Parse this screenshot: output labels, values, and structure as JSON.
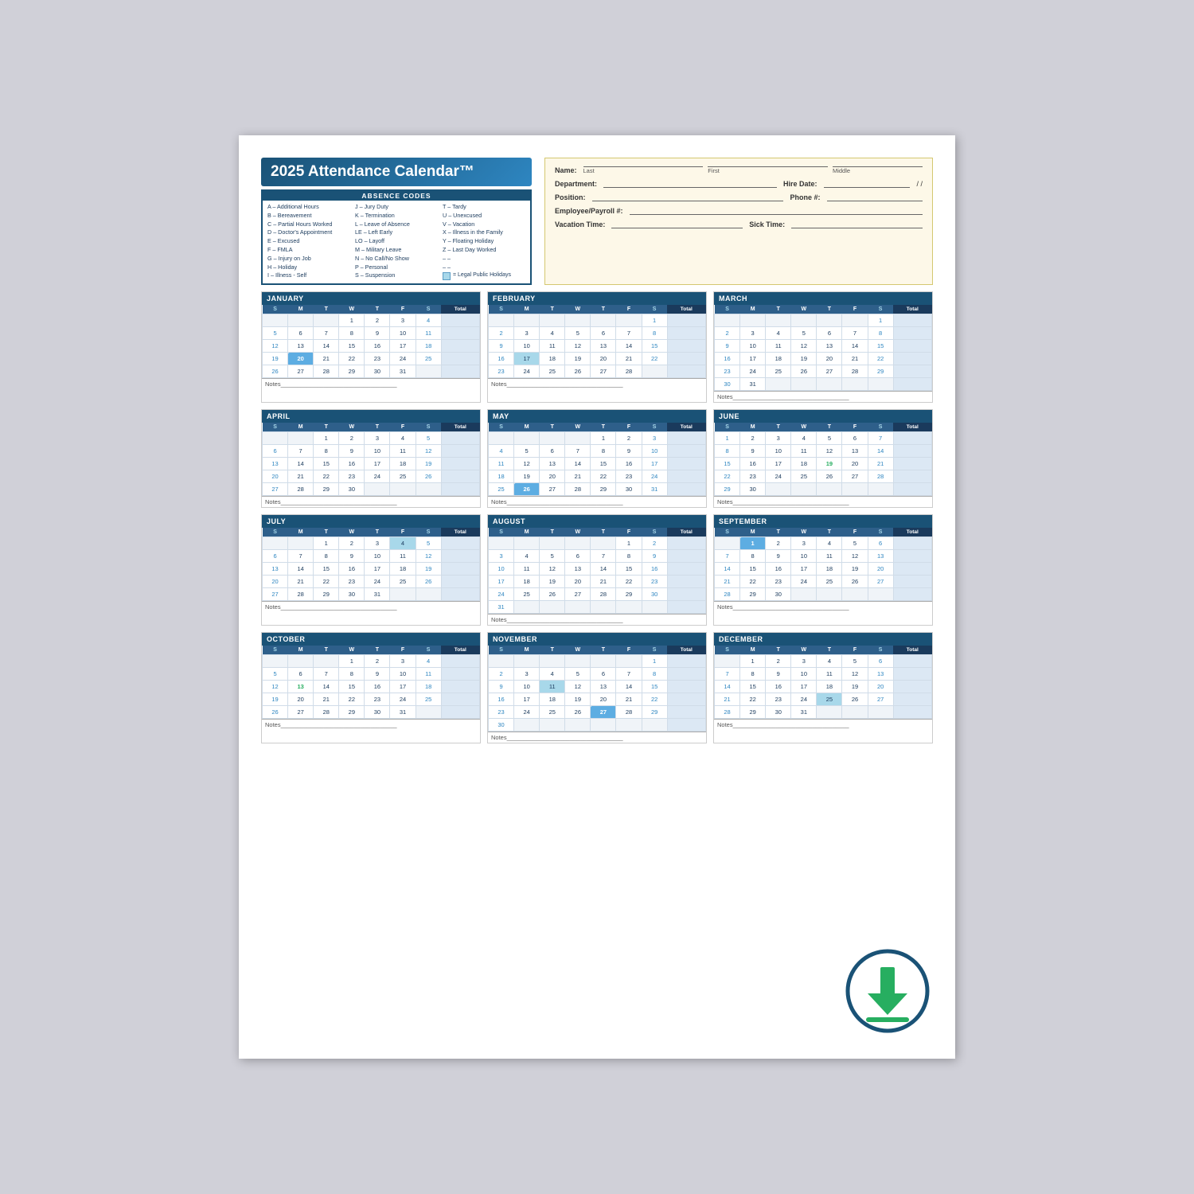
{
  "title": "2025 Attendance Calendar™",
  "absence_codes": {
    "title": "ABSENCE CODES",
    "col1": [
      "A – Additional Hours",
      "B – Bereavement",
      "C – Partial Hours Worked",
      "D – Doctor's Appointment",
      "E – Excused",
      "F – FMLA",
      "G – Injury on Job",
      "H – Holiday",
      "I – Illness - Self"
    ],
    "col2": [
      "J – Jury Duty",
      "K – Termination",
      "L – Leave of Absence",
      "LE – Left Early",
      "LO – Layoff",
      "M – Military Leave",
      "N – No Call/No Show",
      "P – Personal",
      "S – Suspension"
    ],
    "col3": [
      "T – Tardy",
      "U – Unexcused",
      "V – Vacation",
      "X – Illness in the Family",
      "Y – Floating Holiday",
      "Z – Last Day Worked",
      "– –",
      "– –",
      "= Legal Public Holidays"
    ]
  },
  "employee_info": {
    "name_label": "Name:",
    "name_last": "Last",
    "name_first": "First",
    "name_middle": "Middle",
    "dept_label": "Department:",
    "hire_label": "Hire Date:",
    "hire_format": "/ /",
    "position_label": "Position:",
    "phone_label": "Phone #:",
    "phone_format": "(____)____",
    "emp_payroll_label": "Employee/Payroll #:",
    "vacation_label": "Vacation Time:",
    "sick_label": "Sick Time:"
  },
  "months": [
    {
      "name": "JANUARY",
      "days_header": [
        "S",
        "M",
        "T",
        "W",
        "T",
        "F",
        "S",
        "Total"
      ],
      "weeks": [
        [
          "",
          "",
          "",
          "1",
          "2",
          "3",
          "4",
          ""
        ],
        [
          "5",
          "6",
          "7",
          "8",
          "9",
          "10",
          "11",
          ""
        ],
        [
          "12",
          "13",
          "14",
          "15",
          "16",
          "17",
          "18",
          ""
        ],
        [
          "19",
          "20",
          "21",
          "22",
          "23",
          "24",
          "25",
          ""
        ],
        [
          "26",
          "27",
          "28",
          "29",
          "30",
          "31",
          "",
          ""
        ]
      ],
      "special": {
        "20": "highlighted"
      },
      "notes": "Notes"
    },
    {
      "name": "FEBRUARY",
      "days_header": [
        "S",
        "M",
        "T",
        "W",
        "T",
        "F",
        "S",
        "Total"
      ],
      "weeks": [
        [
          "",
          "",
          "",
          "",
          "",
          "",
          "1",
          ""
        ],
        [
          "2",
          "3",
          "4",
          "5",
          "6",
          "7",
          "8",
          ""
        ],
        [
          "9",
          "10",
          "11",
          "12",
          "13",
          "14",
          "15",
          ""
        ],
        [
          "16",
          "17",
          "18",
          "19",
          "20",
          "21",
          "22",
          ""
        ],
        [
          "23",
          "24",
          "25",
          "26",
          "27",
          "28",
          "",
          ""
        ]
      ],
      "special": {
        "17": "holiday"
      },
      "notes": "Notes"
    },
    {
      "name": "MARCH",
      "days_header": [
        "S",
        "M",
        "T",
        "W",
        "T",
        "F",
        "S",
        "Total"
      ],
      "weeks": [
        [
          "",
          "",
          "",
          "",
          "",
          "",
          "1",
          ""
        ],
        [
          "2",
          "3",
          "4",
          "5",
          "6",
          "7",
          "8",
          ""
        ],
        [
          "9",
          "10",
          "11",
          "12",
          "13",
          "14",
          "15",
          ""
        ],
        [
          "16",
          "17",
          "18",
          "19",
          "20",
          "21",
          "22",
          ""
        ],
        [
          "23",
          "24",
          "25",
          "26",
          "27",
          "28",
          "29",
          ""
        ],
        [
          "30",
          "31",
          "",
          "",
          "",
          "",
          "",
          ""
        ]
      ],
      "notes": "Notes"
    },
    {
      "name": "APRIL",
      "days_header": [
        "S",
        "M",
        "T",
        "W",
        "T",
        "F",
        "S",
        "Total"
      ],
      "weeks": [
        [
          "",
          "",
          "1",
          "2",
          "3",
          "4",
          "5",
          ""
        ],
        [
          "6",
          "7",
          "8",
          "9",
          "10",
          "11",
          "12",
          ""
        ],
        [
          "13",
          "14",
          "15",
          "16",
          "17",
          "18",
          "19",
          ""
        ],
        [
          "20",
          "21",
          "22",
          "23",
          "24",
          "25",
          "26",
          ""
        ],
        [
          "27",
          "28",
          "29",
          "30",
          "",
          "",
          "",
          ""
        ]
      ],
      "notes": "Notes"
    },
    {
      "name": "MAY",
      "days_header": [
        "S",
        "M",
        "T",
        "W",
        "T",
        "F",
        "S",
        "Total"
      ],
      "weeks": [
        [
          "",
          "",
          "",
          "",
          "1",
          "2",
          "3",
          ""
        ],
        [
          "4",
          "5",
          "6",
          "7",
          "8",
          "9",
          "10",
          ""
        ],
        [
          "11",
          "12",
          "13",
          "14",
          "15",
          "16",
          "17",
          ""
        ],
        [
          "18",
          "19",
          "20",
          "21",
          "22",
          "23",
          "24",
          ""
        ],
        [
          "25",
          "26",
          "27",
          "28",
          "29",
          "30",
          "31",
          ""
        ]
      ],
      "special": {
        "26": "highlighted"
      },
      "notes": "Notes"
    },
    {
      "name": "JUNE",
      "days_header": [
        "S",
        "M",
        "T",
        "W",
        "T",
        "F",
        "S",
        "Total"
      ],
      "weeks": [
        [
          "1",
          "2",
          "3",
          "4",
          "5",
          "6",
          "7",
          ""
        ],
        [
          "8",
          "9",
          "10",
          "11",
          "12",
          "13",
          "14",
          ""
        ],
        [
          "15",
          "16",
          "17",
          "18",
          "19",
          "20",
          "21",
          ""
        ],
        [
          "22",
          "23",
          "24",
          "25",
          "26",
          "27",
          "28",
          ""
        ],
        [
          "29",
          "30",
          "",
          "",
          "",
          "",
          "",
          ""
        ]
      ],
      "special": {
        "19": "green-highlight"
      },
      "notes": "Notes"
    },
    {
      "name": "JULY",
      "days_header": [
        "S",
        "M",
        "T",
        "W",
        "T",
        "F",
        "S",
        "Total"
      ],
      "weeks": [
        [
          "",
          "",
          "1",
          "2",
          "3",
          "4",
          "5",
          ""
        ],
        [
          "6",
          "7",
          "8",
          "9",
          "10",
          "11",
          "12",
          ""
        ],
        [
          "13",
          "14",
          "15",
          "16",
          "17",
          "18",
          "19",
          ""
        ],
        [
          "20",
          "21",
          "22",
          "23",
          "24",
          "25",
          "26",
          ""
        ],
        [
          "27",
          "28",
          "29",
          "30",
          "31",
          "",
          "",
          ""
        ]
      ],
      "special": {
        "4": "holiday"
      },
      "notes": "Notes"
    },
    {
      "name": "AUGUST",
      "days_header": [
        "S",
        "M",
        "T",
        "W",
        "T",
        "F",
        "S",
        "Total"
      ],
      "weeks": [
        [
          "",
          "",
          "",
          "",
          "",
          "1",
          "2",
          ""
        ],
        [
          "3",
          "4",
          "5",
          "6",
          "7",
          "8",
          "9",
          ""
        ],
        [
          "10",
          "11",
          "12",
          "13",
          "14",
          "15",
          "16",
          ""
        ],
        [
          "17",
          "18",
          "19",
          "20",
          "21",
          "22",
          "23",
          ""
        ],
        [
          "24",
          "25",
          "26",
          "27",
          "28",
          "29",
          "30",
          ""
        ],
        [
          "31",
          "",
          "",
          "",
          "",
          "",
          "",
          ""
        ]
      ],
      "notes": "Notes"
    },
    {
      "name": "SEPTEMBER",
      "days_header": [
        "S",
        "M",
        "T",
        "W",
        "T",
        "F",
        "S",
        "Total"
      ],
      "weeks": [
        [
          "",
          "1",
          "2",
          "3",
          "4",
          "5",
          "6",
          ""
        ],
        [
          "7",
          "8",
          "9",
          "10",
          "11",
          "12",
          "13",
          ""
        ],
        [
          "14",
          "15",
          "16",
          "17",
          "18",
          "19",
          "20",
          ""
        ],
        [
          "21",
          "22",
          "23",
          "24",
          "25",
          "26",
          "27",
          ""
        ],
        [
          "28",
          "29",
          "30",
          "",
          "",
          "",
          "",
          ""
        ]
      ],
      "special": {
        "1": "highlighted"
      },
      "notes": "Notes"
    },
    {
      "name": "OCTOBER",
      "days_header": [
        "S",
        "M",
        "T",
        "W",
        "T",
        "F",
        "S",
        "Total"
      ],
      "weeks": [
        [
          "",
          "",
          "",
          "1",
          "2",
          "3",
          "4",
          ""
        ],
        [
          "5",
          "6",
          "7",
          "8",
          "9",
          "10",
          "11",
          ""
        ],
        [
          "12",
          "13",
          "14",
          "15",
          "16",
          "17",
          "18",
          ""
        ],
        [
          "19",
          "20",
          "21",
          "22",
          "23",
          "24",
          "25",
          ""
        ],
        [
          "26",
          "27",
          "28",
          "29",
          "30",
          "31",
          "",
          ""
        ]
      ],
      "special": {
        "13": "green-highlight"
      },
      "notes": "Notes"
    },
    {
      "name": "NOVEMBER",
      "days_header": [
        "S",
        "M",
        "T",
        "W",
        "T",
        "F",
        "S",
        "Total"
      ],
      "weeks": [
        [
          "",
          "",
          "",
          "",
          "",
          "",
          "1",
          ""
        ],
        [
          "2",
          "3",
          "4",
          "5",
          "6",
          "7",
          "8",
          ""
        ],
        [
          "9",
          "10",
          "11",
          "12",
          "13",
          "14",
          "15",
          ""
        ],
        [
          "16",
          "17",
          "18",
          "19",
          "20",
          "21",
          "22",
          ""
        ],
        [
          "23",
          "24",
          "25",
          "26",
          "27",
          "28",
          "29",
          ""
        ],
        [
          "30",
          "",
          "",
          "",
          "",
          "",
          "",
          ""
        ]
      ],
      "special": {
        "11": "holiday",
        "27": "highlighted"
      },
      "notes": "Notes"
    },
    {
      "name": "DECEMBER",
      "days_header": [
        "S",
        "M",
        "T",
        "W",
        "T",
        "F",
        "S",
        "Total"
      ],
      "weeks": [
        [
          "",
          "1",
          "2",
          "3",
          "4",
          "5",
          "6",
          ""
        ],
        [
          "7",
          "8",
          "9",
          "10",
          "11",
          "12",
          "13",
          ""
        ],
        [
          "14",
          "15",
          "16",
          "17",
          "18",
          "19",
          "20",
          ""
        ],
        [
          "21",
          "22",
          "23",
          "24",
          "25",
          "26",
          "27",
          ""
        ],
        [
          "28",
          "29",
          "30",
          "31",
          "",
          "",
          "",
          ""
        ]
      ],
      "special": {
        "25": "holiday"
      },
      "notes": "Notes"
    }
  ],
  "colors": {
    "dark_blue": "#1a5276",
    "mid_blue": "#2e86c1",
    "light_blue": "#a8d8ea",
    "green": "#27ae60",
    "info_bg": "#fdf8e8",
    "info_border": "#d4c870"
  }
}
